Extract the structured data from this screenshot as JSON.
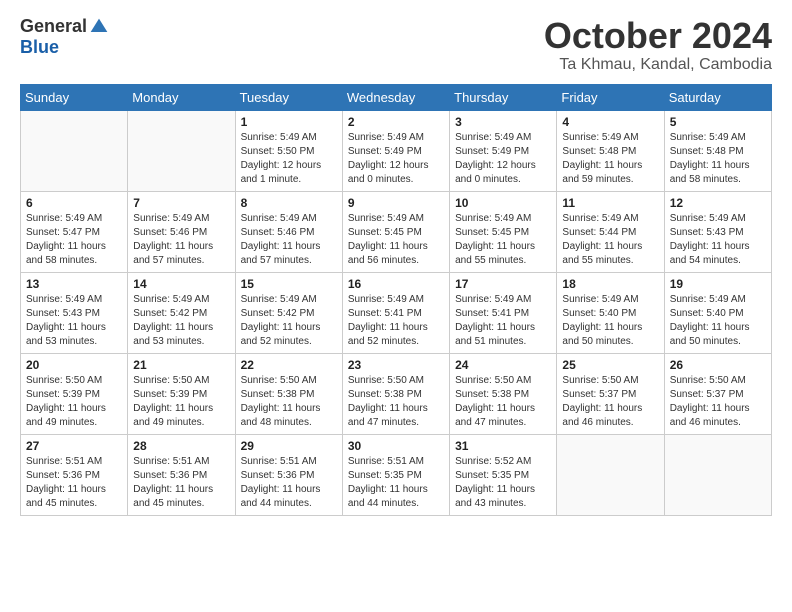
{
  "logo": {
    "general": "General",
    "blue": "Blue"
  },
  "title": "October 2024",
  "subtitle": "Ta Khmau, Kandal, Cambodia",
  "days_of_week": [
    "Sunday",
    "Monday",
    "Tuesday",
    "Wednesday",
    "Thursday",
    "Friday",
    "Saturday"
  ],
  "weeks": [
    [
      {
        "day": "",
        "info": ""
      },
      {
        "day": "",
        "info": ""
      },
      {
        "day": "1",
        "info": "Sunrise: 5:49 AM\nSunset: 5:50 PM\nDaylight: 12 hours\nand 1 minute."
      },
      {
        "day": "2",
        "info": "Sunrise: 5:49 AM\nSunset: 5:49 PM\nDaylight: 12 hours\nand 0 minutes."
      },
      {
        "day": "3",
        "info": "Sunrise: 5:49 AM\nSunset: 5:49 PM\nDaylight: 12 hours\nand 0 minutes."
      },
      {
        "day": "4",
        "info": "Sunrise: 5:49 AM\nSunset: 5:48 PM\nDaylight: 11 hours\nand 59 minutes."
      },
      {
        "day": "5",
        "info": "Sunrise: 5:49 AM\nSunset: 5:48 PM\nDaylight: 11 hours\nand 58 minutes."
      }
    ],
    [
      {
        "day": "6",
        "info": "Sunrise: 5:49 AM\nSunset: 5:47 PM\nDaylight: 11 hours\nand 58 minutes."
      },
      {
        "day": "7",
        "info": "Sunrise: 5:49 AM\nSunset: 5:46 PM\nDaylight: 11 hours\nand 57 minutes."
      },
      {
        "day": "8",
        "info": "Sunrise: 5:49 AM\nSunset: 5:46 PM\nDaylight: 11 hours\nand 57 minutes."
      },
      {
        "day": "9",
        "info": "Sunrise: 5:49 AM\nSunset: 5:45 PM\nDaylight: 11 hours\nand 56 minutes."
      },
      {
        "day": "10",
        "info": "Sunrise: 5:49 AM\nSunset: 5:45 PM\nDaylight: 11 hours\nand 55 minutes."
      },
      {
        "day": "11",
        "info": "Sunrise: 5:49 AM\nSunset: 5:44 PM\nDaylight: 11 hours\nand 55 minutes."
      },
      {
        "day": "12",
        "info": "Sunrise: 5:49 AM\nSunset: 5:43 PM\nDaylight: 11 hours\nand 54 minutes."
      }
    ],
    [
      {
        "day": "13",
        "info": "Sunrise: 5:49 AM\nSunset: 5:43 PM\nDaylight: 11 hours\nand 53 minutes."
      },
      {
        "day": "14",
        "info": "Sunrise: 5:49 AM\nSunset: 5:42 PM\nDaylight: 11 hours\nand 53 minutes."
      },
      {
        "day": "15",
        "info": "Sunrise: 5:49 AM\nSunset: 5:42 PM\nDaylight: 11 hours\nand 52 minutes."
      },
      {
        "day": "16",
        "info": "Sunrise: 5:49 AM\nSunset: 5:41 PM\nDaylight: 11 hours\nand 52 minutes."
      },
      {
        "day": "17",
        "info": "Sunrise: 5:49 AM\nSunset: 5:41 PM\nDaylight: 11 hours\nand 51 minutes."
      },
      {
        "day": "18",
        "info": "Sunrise: 5:49 AM\nSunset: 5:40 PM\nDaylight: 11 hours\nand 50 minutes."
      },
      {
        "day": "19",
        "info": "Sunrise: 5:49 AM\nSunset: 5:40 PM\nDaylight: 11 hours\nand 50 minutes."
      }
    ],
    [
      {
        "day": "20",
        "info": "Sunrise: 5:50 AM\nSunset: 5:39 PM\nDaylight: 11 hours\nand 49 minutes."
      },
      {
        "day": "21",
        "info": "Sunrise: 5:50 AM\nSunset: 5:39 PM\nDaylight: 11 hours\nand 49 minutes."
      },
      {
        "day": "22",
        "info": "Sunrise: 5:50 AM\nSunset: 5:38 PM\nDaylight: 11 hours\nand 48 minutes."
      },
      {
        "day": "23",
        "info": "Sunrise: 5:50 AM\nSunset: 5:38 PM\nDaylight: 11 hours\nand 47 minutes."
      },
      {
        "day": "24",
        "info": "Sunrise: 5:50 AM\nSunset: 5:38 PM\nDaylight: 11 hours\nand 47 minutes."
      },
      {
        "day": "25",
        "info": "Sunrise: 5:50 AM\nSunset: 5:37 PM\nDaylight: 11 hours\nand 46 minutes."
      },
      {
        "day": "26",
        "info": "Sunrise: 5:50 AM\nSunset: 5:37 PM\nDaylight: 11 hours\nand 46 minutes."
      }
    ],
    [
      {
        "day": "27",
        "info": "Sunrise: 5:51 AM\nSunset: 5:36 PM\nDaylight: 11 hours\nand 45 minutes."
      },
      {
        "day": "28",
        "info": "Sunrise: 5:51 AM\nSunset: 5:36 PM\nDaylight: 11 hours\nand 45 minutes."
      },
      {
        "day": "29",
        "info": "Sunrise: 5:51 AM\nSunset: 5:36 PM\nDaylight: 11 hours\nand 44 minutes."
      },
      {
        "day": "30",
        "info": "Sunrise: 5:51 AM\nSunset: 5:35 PM\nDaylight: 11 hours\nand 44 minutes."
      },
      {
        "day": "31",
        "info": "Sunrise: 5:52 AM\nSunset: 5:35 PM\nDaylight: 11 hours\nand 43 minutes."
      },
      {
        "day": "",
        "info": ""
      },
      {
        "day": "",
        "info": ""
      }
    ]
  ]
}
